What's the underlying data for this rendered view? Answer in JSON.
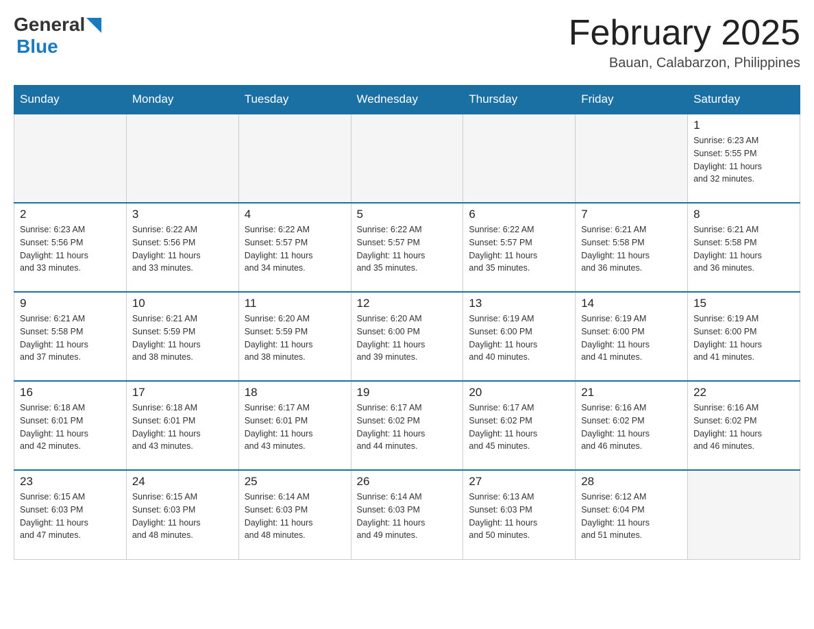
{
  "header": {
    "logo": {
      "general": "General",
      "blue": "Blue"
    },
    "title": "February 2025",
    "location": "Bauan, Calabarzon, Philippines"
  },
  "days_of_week": [
    "Sunday",
    "Monday",
    "Tuesday",
    "Wednesday",
    "Thursday",
    "Friday",
    "Saturday"
  ],
  "weeks": [
    [
      {
        "day": "",
        "info": ""
      },
      {
        "day": "",
        "info": ""
      },
      {
        "day": "",
        "info": ""
      },
      {
        "day": "",
        "info": ""
      },
      {
        "day": "",
        "info": ""
      },
      {
        "day": "",
        "info": ""
      },
      {
        "day": "1",
        "info": "Sunrise: 6:23 AM\nSunset: 5:55 PM\nDaylight: 11 hours\nand 32 minutes."
      }
    ],
    [
      {
        "day": "2",
        "info": "Sunrise: 6:23 AM\nSunset: 5:56 PM\nDaylight: 11 hours\nand 33 minutes."
      },
      {
        "day": "3",
        "info": "Sunrise: 6:22 AM\nSunset: 5:56 PM\nDaylight: 11 hours\nand 33 minutes."
      },
      {
        "day": "4",
        "info": "Sunrise: 6:22 AM\nSunset: 5:57 PM\nDaylight: 11 hours\nand 34 minutes."
      },
      {
        "day": "5",
        "info": "Sunrise: 6:22 AM\nSunset: 5:57 PM\nDaylight: 11 hours\nand 35 minutes."
      },
      {
        "day": "6",
        "info": "Sunrise: 6:22 AM\nSunset: 5:57 PM\nDaylight: 11 hours\nand 35 minutes."
      },
      {
        "day": "7",
        "info": "Sunrise: 6:21 AM\nSunset: 5:58 PM\nDaylight: 11 hours\nand 36 minutes."
      },
      {
        "day": "8",
        "info": "Sunrise: 6:21 AM\nSunset: 5:58 PM\nDaylight: 11 hours\nand 36 minutes."
      }
    ],
    [
      {
        "day": "9",
        "info": "Sunrise: 6:21 AM\nSunset: 5:58 PM\nDaylight: 11 hours\nand 37 minutes."
      },
      {
        "day": "10",
        "info": "Sunrise: 6:21 AM\nSunset: 5:59 PM\nDaylight: 11 hours\nand 38 minutes."
      },
      {
        "day": "11",
        "info": "Sunrise: 6:20 AM\nSunset: 5:59 PM\nDaylight: 11 hours\nand 38 minutes."
      },
      {
        "day": "12",
        "info": "Sunrise: 6:20 AM\nSunset: 6:00 PM\nDaylight: 11 hours\nand 39 minutes."
      },
      {
        "day": "13",
        "info": "Sunrise: 6:19 AM\nSunset: 6:00 PM\nDaylight: 11 hours\nand 40 minutes."
      },
      {
        "day": "14",
        "info": "Sunrise: 6:19 AM\nSunset: 6:00 PM\nDaylight: 11 hours\nand 41 minutes."
      },
      {
        "day": "15",
        "info": "Sunrise: 6:19 AM\nSunset: 6:00 PM\nDaylight: 11 hours\nand 41 minutes."
      }
    ],
    [
      {
        "day": "16",
        "info": "Sunrise: 6:18 AM\nSunset: 6:01 PM\nDaylight: 11 hours\nand 42 minutes."
      },
      {
        "day": "17",
        "info": "Sunrise: 6:18 AM\nSunset: 6:01 PM\nDaylight: 11 hours\nand 43 minutes."
      },
      {
        "day": "18",
        "info": "Sunrise: 6:17 AM\nSunset: 6:01 PM\nDaylight: 11 hours\nand 43 minutes."
      },
      {
        "day": "19",
        "info": "Sunrise: 6:17 AM\nSunset: 6:02 PM\nDaylight: 11 hours\nand 44 minutes."
      },
      {
        "day": "20",
        "info": "Sunrise: 6:17 AM\nSunset: 6:02 PM\nDaylight: 11 hours\nand 45 minutes."
      },
      {
        "day": "21",
        "info": "Sunrise: 6:16 AM\nSunset: 6:02 PM\nDaylight: 11 hours\nand 46 minutes."
      },
      {
        "day": "22",
        "info": "Sunrise: 6:16 AM\nSunset: 6:02 PM\nDaylight: 11 hours\nand 46 minutes."
      }
    ],
    [
      {
        "day": "23",
        "info": "Sunrise: 6:15 AM\nSunset: 6:03 PM\nDaylight: 11 hours\nand 47 minutes."
      },
      {
        "day": "24",
        "info": "Sunrise: 6:15 AM\nSunset: 6:03 PM\nDaylight: 11 hours\nand 48 minutes."
      },
      {
        "day": "25",
        "info": "Sunrise: 6:14 AM\nSunset: 6:03 PM\nDaylight: 11 hours\nand 48 minutes."
      },
      {
        "day": "26",
        "info": "Sunrise: 6:14 AM\nSunset: 6:03 PM\nDaylight: 11 hours\nand 49 minutes."
      },
      {
        "day": "27",
        "info": "Sunrise: 6:13 AM\nSunset: 6:03 PM\nDaylight: 11 hours\nand 50 minutes."
      },
      {
        "day": "28",
        "info": "Sunrise: 6:12 AM\nSunset: 6:04 PM\nDaylight: 11 hours\nand 51 minutes."
      },
      {
        "day": "",
        "info": ""
      }
    ]
  ]
}
